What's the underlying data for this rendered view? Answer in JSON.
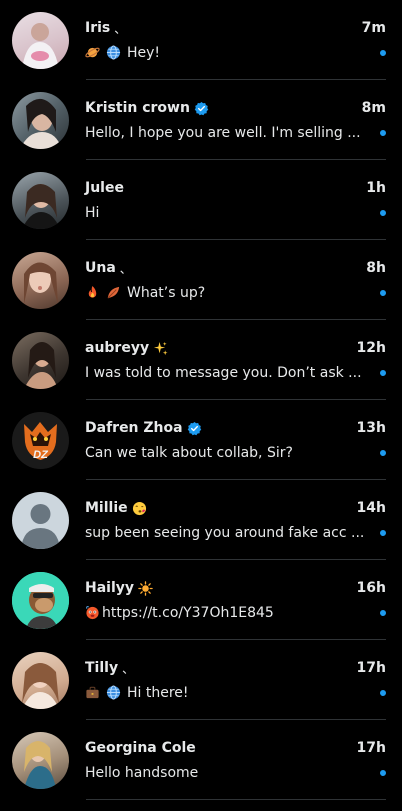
{
  "colors": {
    "background": "#000000",
    "text": "#e7e9ea",
    "unread_dot": "#1d9bf0",
    "divider": "#2f3336",
    "verified_badge": "#1d9bf0"
  },
  "conversations": [
    {
      "name": "Iris",
      "suffix": "、",
      "time": "7m",
      "preview_icons": [
        "planet-emoji",
        "globe-emoji"
      ],
      "preview": "Hey!"
    },
    {
      "name": "Kristin crown",
      "verified": true,
      "time": "8m",
      "preview": "Hello, I hope you are well. I'm selling ..."
    },
    {
      "name": "Julee",
      "time": "1h",
      "preview": "Hi"
    },
    {
      "name": "Una",
      "suffix": "、",
      "time": "8h",
      "preview_icons": [
        "fire-emoji",
        "leaf-emoji"
      ],
      "preview": "What’s up?"
    },
    {
      "name": "aubreyy",
      "suffix_icon": "sparkles-emoji",
      "time": "12h",
      "preview": "I was told to message you. Don’t ask ..."
    },
    {
      "name": "Dafren Zhoa",
      "verified": true,
      "time": "13h",
      "preview": "Can we talk about collab, Sir?"
    },
    {
      "name": "Millie",
      "suffix_icon": "kissing-face-emoji",
      "time": "14h",
      "preview": "sup been seeing you around fake acc ..."
    },
    {
      "name": "Hailyy",
      "suffix_icon": "sun-emoji",
      "time": "16h",
      "preview_icons": [
        "hot-face-emoji"
      ],
      "preview": "https://t.co/Y37Oh1E845"
    },
    {
      "name": "Tilly",
      "suffix": "、",
      "time": "17h",
      "preview_icons": [
        "briefcase-emoji",
        "globe-emoji"
      ],
      "preview": "Hi there!"
    },
    {
      "name": "Georgina Cole",
      "time": "17h",
      "preview": "Hello handsome"
    }
  ]
}
